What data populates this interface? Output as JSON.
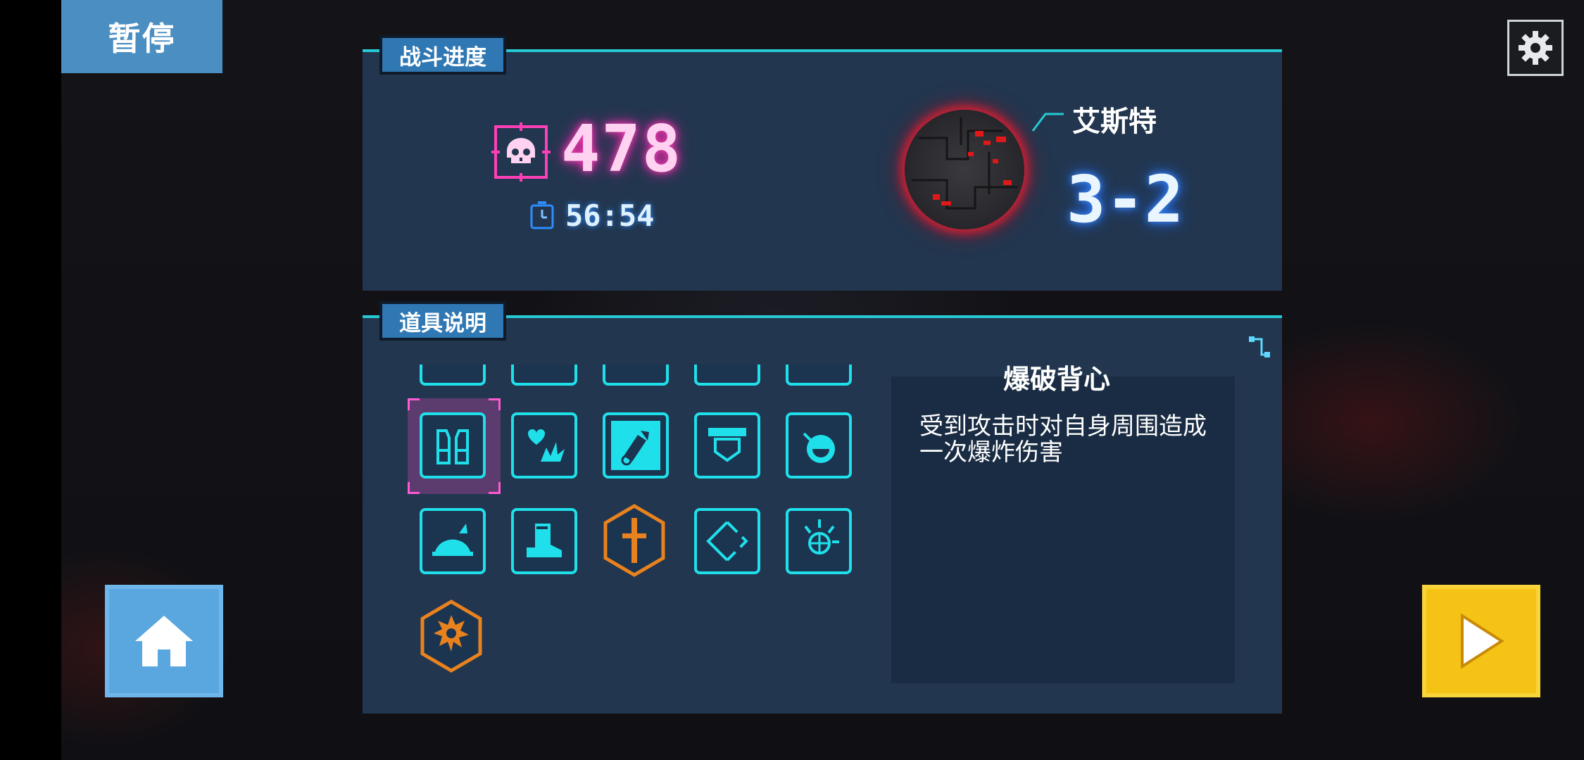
{
  "hud": {
    "pause_label": "暂停",
    "settings_icon": "gear-icon",
    "home_icon": "home-icon",
    "play_icon": "play-icon"
  },
  "battle_progress": {
    "title": "战斗进度",
    "kill_count": "478",
    "time": "56:54",
    "level_name": "艾斯特",
    "level_stage": "3-2"
  },
  "item_info": {
    "title": "道具说明",
    "selected_item": {
      "name": "爆破背心",
      "description": "受到攻击时对自身周围造成一次爆炸伤害"
    },
    "grid_rows": [
      [
        "partial",
        "partial",
        "partial",
        "partial",
        "partial"
      ],
      [
        "vest-icon",
        "heart-explosion-icon",
        "rocket-icon",
        "shield-belt-icon",
        "bomb-fruit-icon"
      ],
      [
        "helmet-icon",
        "boot-icon",
        "dagger-badge-icon",
        "diamond-target-icon",
        "sunburst-target-icon"
      ],
      [
        "explosion-badge-icon"
      ]
    ]
  },
  "colors": {
    "panel_bg": "#22364f",
    "accent_cyan": "#1fe0ea",
    "kill_pink": "#ff3fb8",
    "stage_blue": "#3c8dff",
    "pause_blue": "#4b8ec2",
    "play_yellow": "#f4c315",
    "badge_orange": "#e8821e"
  }
}
